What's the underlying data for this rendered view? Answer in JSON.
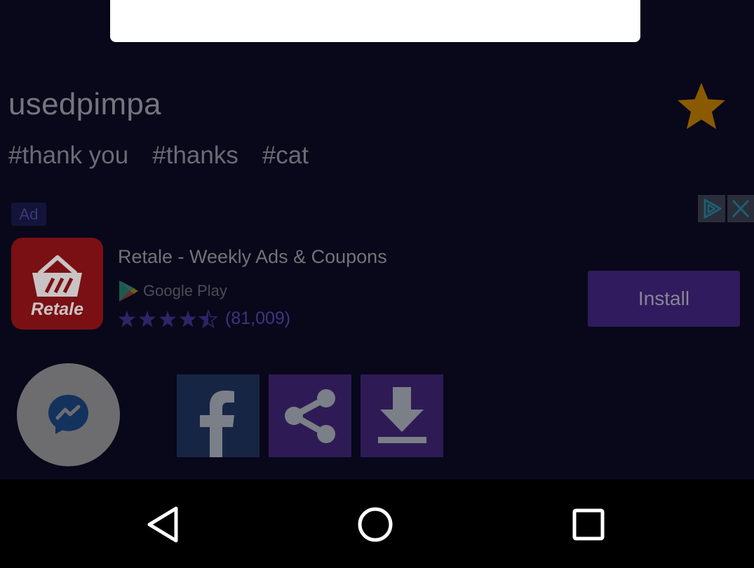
{
  "post": {
    "username": "usedpimpa",
    "tags": [
      "#thank you",
      "#thanks",
      "#cat"
    ]
  },
  "ad": {
    "badge": "Ad",
    "app_icon_label": "Retale",
    "title": "Retale - Weekly Ads & Coupons",
    "store": "Google Play",
    "rating": 4.5,
    "rating_count": "(81,009)",
    "install_label": "Install"
  },
  "icons": {
    "favorite": "star-icon",
    "adchoices": "adchoices-icon",
    "close": "close-icon",
    "messenger": "messenger-icon",
    "facebook": "facebook-icon",
    "share": "share-icon",
    "download": "download-icon",
    "back": "back-triangle-icon",
    "home": "home-circle-icon",
    "recent": "recent-square-icon"
  },
  "colors": {
    "overlay_background": "#08081a",
    "star": "#8a5a00",
    "install_button": "#2f1b5e",
    "facebook_tile": "#172545",
    "share_tile": "#2e1b55"
  }
}
